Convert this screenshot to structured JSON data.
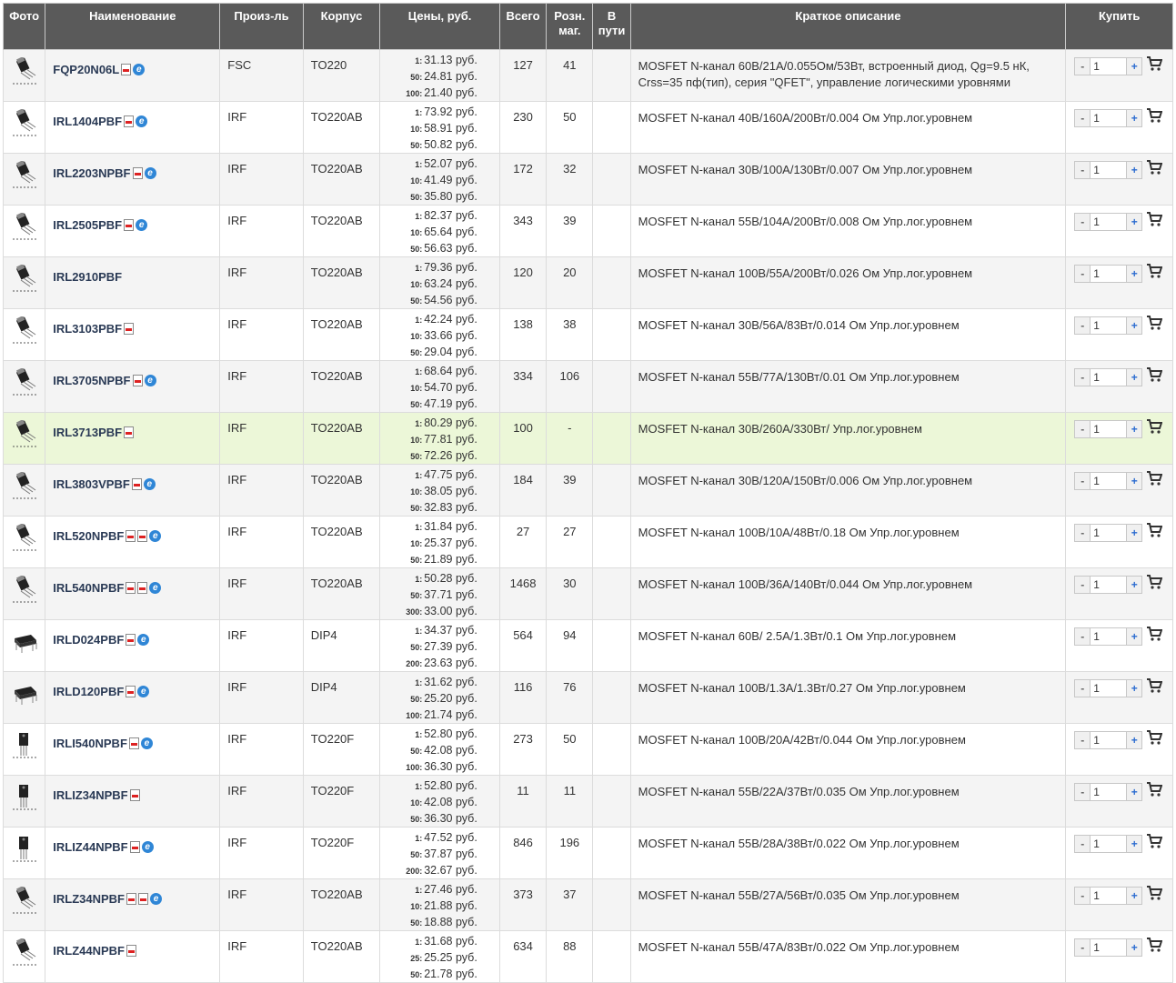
{
  "headers": [
    "Фото",
    "Наименование",
    "Произ-ль",
    "Корпус",
    "Цены, руб.",
    "Всего",
    "Розн. маг.",
    "В пути",
    "Краткое описание",
    "Купить"
  ],
  "rows": [
    {
      "pkg": "to220",
      "name": "FQP20N06L",
      "docs": [
        "pdf",
        "ie"
      ],
      "maker": "FSC",
      "case": "TO220",
      "prices": [
        {
          "q": "1:",
          "p": "31.13 руб."
        },
        {
          "q": "50:",
          "p": "24.81 руб."
        },
        {
          "q": "100:",
          "p": "21.40 руб."
        }
      ],
      "total": "127",
      "retail": "41",
      "transit": "",
      "desc": "MOSFET N-канал 60В/21А/0.055Ом/53Вт, встроенный диод, Qg=9.5 нК, Crss=35 пф(тип), серия \"QFET\", управление логическими уровнями",
      "qty": "1"
    },
    {
      "pkg": "to220",
      "name": "IRL1404PBF",
      "docs": [
        "pdf",
        "ie"
      ],
      "maker": "IRF",
      "case": "TO220AB",
      "prices": [
        {
          "q": "1:",
          "p": "73.92 руб."
        },
        {
          "q": "10:",
          "p": "58.91 руб."
        },
        {
          "q": "50:",
          "p": "50.82 руб."
        }
      ],
      "total": "230",
      "retail": "50",
      "transit": "",
      "desc": "MOSFET N-канал 40В/160А/200Вт/0.004 Ом Упр.лог.уровнем",
      "qty": "1"
    },
    {
      "pkg": "to220",
      "name": "IRL2203NPBF",
      "docs": [
        "pdf",
        "ie"
      ],
      "maker": "IRF",
      "case": "TO220AB",
      "prices": [
        {
          "q": "1:",
          "p": "52.07 руб."
        },
        {
          "q": "10:",
          "p": "41.49 руб."
        },
        {
          "q": "50:",
          "p": "35.80 руб."
        }
      ],
      "total": "172",
      "retail": "32",
      "transit": "",
      "desc": "MOSFET N-канал 30В/100А/130Вт/0.007 Ом Упр.лог.уровнем",
      "qty": "1"
    },
    {
      "pkg": "to220",
      "name": "IRL2505PBF",
      "docs": [
        "pdf",
        "ie"
      ],
      "maker": "IRF",
      "case": "TO220AB",
      "prices": [
        {
          "q": "1:",
          "p": "82.37 руб."
        },
        {
          "q": "10:",
          "p": "65.64 руб."
        },
        {
          "q": "50:",
          "p": "56.63 руб."
        }
      ],
      "total": "343",
      "retail": "39",
      "transit": "",
      "desc": "MOSFET N-канал 55В/104А/200Вт/0.008 Ом Упр.лог.уровнем",
      "qty": "1"
    },
    {
      "pkg": "to220",
      "name": "IRL2910PBF",
      "docs": [],
      "maker": "IRF",
      "case": "TO220AB",
      "prices": [
        {
          "q": "1:",
          "p": "79.36 руб."
        },
        {
          "q": "10:",
          "p": "63.24 руб."
        },
        {
          "q": "50:",
          "p": "54.56 руб."
        }
      ],
      "total": "120",
      "retail": "20",
      "transit": "",
      "desc": "MOSFET N-канал 100В/55А/200Вт/0.026 Ом Упр.лог.уровнем",
      "qty": "1"
    },
    {
      "pkg": "to220",
      "name": "IRL3103PBF",
      "docs": [
        "pdf"
      ],
      "maker": "IRF",
      "case": "TO220AB",
      "prices": [
        {
          "q": "1:",
          "p": "42.24 руб."
        },
        {
          "q": "10:",
          "p": "33.66 руб."
        },
        {
          "q": "50:",
          "p": "29.04 руб."
        }
      ],
      "total": "138",
      "retail": "38",
      "transit": "",
      "desc": "MOSFET N-канал 30В/56А/83Вт/0.014 Ом Упр.лог.уровнем",
      "qty": "1"
    },
    {
      "pkg": "to220",
      "name": "IRL3705NPBF",
      "docs": [
        "pdf",
        "ie"
      ],
      "maker": "IRF",
      "case": "TO220AB",
      "prices": [
        {
          "q": "1:",
          "p": "68.64 руб."
        },
        {
          "q": "10:",
          "p": "54.70 руб."
        },
        {
          "q": "50:",
          "p": "47.19 руб."
        }
      ],
      "total": "334",
      "retail": "106",
      "transit": "",
      "desc": "MOSFET N-канал 55В/77А/130Вт/0.01 Ом Упр.лог.уровнем",
      "qty": "1"
    },
    {
      "pkg": "to220",
      "name": "IRL3713PBF",
      "docs": [
        "pdf"
      ],
      "maker": "IRF",
      "case": "TO220AB",
      "prices": [
        {
          "q": "1:",
          "p": "80.29 руб."
        },
        {
          "q": "10:",
          "p": "77.81 руб."
        },
        {
          "q": "50:",
          "p": "72.26 руб."
        }
      ],
      "total": "100",
      "retail": "-",
      "transit": "",
      "desc": "MOSFET N-канал 30В/260А/330Вт/ Упр.лог.уровнем",
      "qty": "1",
      "highlight": true
    },
    {
      "pkg": "to220",
      "name": "IRL3803VPBF",
      "docs": [
        "pdf",
        "ie"
      ],
      "maker": "IRF",
      "case": "TO220AB",
      "prices": [
        {
          "q": "1:",
          "p": "47.75 руб."
        },
        {
          "q": "10:",
          "p": "38.05 руб."
        },
        {
          "q": "50:",
          "p": "32.83 руб."
        }
      ],
      "total": "184",
      "retail": "39",
      "transit": "",
      "desc": "MOSFET N-канал 30В/120А/150Вт/0.006 Ом Упр.лог.уровнем",
      "qty": "1"
    },
    {
      "pkg": "to220",
      "name": "IRL520NPBF",
      "docs": [
        "pdf",
        "pdf",
        "ie"
      ],
      "maker": "IRF",
      "case": "TO220AB",
      "prices": [
        {
          "q": "1:",
          "p": "31.84 руб."
        },
        {
          "q": "10:",
          "p": "25.37 руб."
        },
        {
          "q": "50:",
          "p": "21.89 руб."
        }
      ],
      "total": "27",
      "retail": "27",
      "transit": "",
      "desc": "MOSFET N-канал 100В/10А/48Вт/0.18 Ом Упр.лог.уровнем",
      "qty": "1"
    },
    {
      "pkg": "to220",
      "name": "IRL540NPBF",
      "docs": [
        "pdf",
        "pdf",
        "ie"
      ],
      "maker": "IRF",
      "case": "TO220AB",
      "prices": [
        {
          "q": "1:",
          "p": "50.28 руб."
        },
        {
          "q": "50:",
          "p": "37.71 руб."
        },
        {
          "q": "300:",
          "p": "33.00 руб."
        }
      ],
      "total": "1468",
      "retail": "30",
      "transit": "",
      "desc": "MOSFET N-канал 100В/36А/140Вт/0.044 Ом Упр.лог.уровнем",
      "qty": "1"
    },
    {
      "pkg": "dip",
      "name": "IRLD024PBF",
      "docs": [
        "pdf",
        "ie"
      ],
      "maker": "IRF",
      "case": "DIP4",
      "prices": [
        {
          "q": "1:",
          "p": "34.37 руб."
        },
        {
          "q": "50:",
          "p": "27.39 руб."
        },
        {
          "q": "200:",
          "p": "23.63 руб."
        }
      ],
      "total": "564",
      "retail": "94",
      "transit": "",
      "desc": "MOSFET N-канал 60В/ 2.5А/1.3Вт/0.1 Ом Упр.лог.уровнем",
      "qty": "1"
    },
    {
      "pkg": "dip",
      "name": "IRLD120PBF",
      "docs": [
        "pdf",
        "ie"
      ],
      "maker": "IRF",
      "case": "DIP4",
      "prices": [
        {
          "q": "1:",
          "p": "31.62 руб."
        },
        {
          "q": "50:",
          "p": "25.20 руб."
        },
        {
          "q": "100:",
          "p": "21.74 руб."
        }
      ],
      "total": "116",
      "retail": "76",
      "transit": "",
      "desc": "MOSFET N-канал 100В/1.3А/1.3Вт/0.27 Ом Упр.лог.уровнем",
      "qty": "1"
    },
    {
      "pkg": "to220f",
      "name": "IRLI540NPBF",
      "docs": [
        "pdf",
        "ie"
      ],
      "maker": "IRF",
      "case": "TO220F",
      "prices": [
        {
          "q": "1:",
          "p": "52.80 руб."
        },
        {
          "q": "50:",
          "p": "42.08 руб."
        },
        {
          "q": "100:",
          "p": "36.30 руб."
        }
      ],
      "total": "273",
      "retail": "50",
      "transit": "",
      "desc": "MOSFET N-канал 100В/20А/42Вт/0.044 Ом Упр.лог.уровнем",
      "qty": "1"
    },
    {
      "pkg": "to220f",
      "name": "IRLIZ34NPBF",
      "docs": [
        "pdf"
      ],
      "maker": "IRF",
      "case": "TO220F",
      "prices": [
        {
          "q": "1:",
          "p": "52.80 руб."
        },
        {
          "q": "10:",
          "p": "42.08 руб."
        },
        {
          "q": "50:",
          "p": "36.30 руб."
        }
      ],
      "total": "11",
      "retail": "11",
      "transit": "",
      "desc": "MOSFET N-канал 55В/22А/37Вт/0.035 Ом Упр.лог.уровнем",
      "qty": "1"
    },
    {
      "pkg": "to220f",
      "name": "IRLIZ44NPBF",
      "docs": [
        "pdf",
        "ie"
      ],
      "maker": "IRF",
      "case": "TO220F",
      "prices": [
        {
          "q": "1:",
          "p": "47.52 руб."
        },
        {
          "q": "50:",
          "p": "37.87 руб."
        },
        {
          "q": "200:",
          "p": "32.67 руб."
        }
      ],
      "total": "846",
      "retail": "196",
      "transit": "",
      "desc": "MOSFET N-канал 55В/28А/38Вт/0.022 Ом Упр.лог.уровнем",
      "qty": "1"
    },
    {
      "pkg": "to220",
      "name": "IRLZ34NPBF",
      "docs": [
        "pdf",
        "pdf",
        "ie"
      ],
      "maker": "IRF",
      "case": "TO220AB",
      "prices": [
        {
          "q": "1:",
          "p": "27.46 руб."
        },
        {
          "q": "10:",
          "p": "21.88 руб."
        },
        {
          "q": "50:",
          "p": "18.88 руб."
        }
      ],
      "total": "373",
      "retail": "37",
      "transit": "",
      "desc": "MOSFET N-канал 55В/27А/56Вт/0.035 Ом Упр.лог.уровнем",
      "qty": "1"
    },
    {
      "pkg": "to220",
      "name": "IRLZ44NPBF",
      "docs": [
        "pdf"
      ],
      "maker": "IRF",
      "case": "TO220AB",
      "prices": [
        {
          "q": "1:",
          "p": "31.68 руб."
        },
        {
          "q": "25:",
          "p": "25.25 руб."
        },
        {
          "q": "50:",
          "p": "21.78 руб."
        }
      ],
      "total": "634",
      "retail": "88",
      "transit": "",
      "desc": "MOSFET N-канал 55В/47А/83Вт/0.022 Ом Упр.лог.уровнем",
      "qty": "1"
    }
  ],
  "buy": {
    "minus": "-",
    "plus": "+"
  },
  "colors": {
    "header": "#5a5a5a",
    "row_odd": "#f4f4f4",
    "row_even": "#ffffff",
    "highlight": "#ecf7d8",
    "link": "#2a3a55"
  }
}
